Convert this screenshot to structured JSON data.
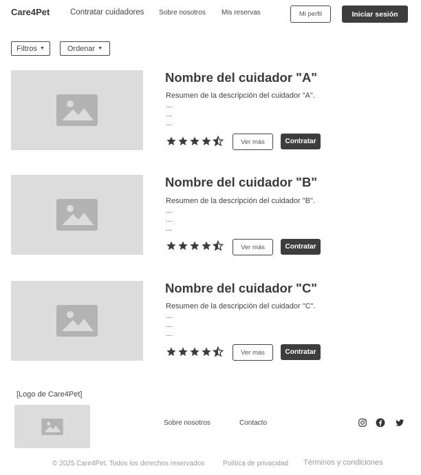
{
  "header": {
    "logo": "Care4Pet",
    "nav": [
      "Contratar cuidadores",
      "Sobre nosotros",
      "Mis reservas"
    ],
    "profile_button": "Mi perfil",
    "login_button": "Iniciar sesión"
  },
  "filters": {
    "filter_label": "Filtros",
    "sort_label": "Ordenar"
  },
  "caregivers": [
    {
      "name": "Nombre del cuidador \"A\"",
      "summary": "Resumen de la descripción del cuidador \"A\".",
      "rating": 4.5,
      "view_label": "Ver más",
      "hire_label": "Contratar"
    },
    {
      "name": "Nombre del cuidador \"B\"",
      "summary": "Resumen de la descripción del cuidador \"B\".",
      "rating": 4.5,
      "view_label": "Ver más",
      "hire_label": "Contratar"
    },
    {
      "name": "Nombre del cuidador \"C\"",
      "summary": "Resumen de la descripción del cuidador \"C\".",
      "rating": 4.5,
      "view_label": "Ver más",
      "hire_label": "Contratar"
    }
  ],
  "ellipsis": "...",
  "footer": {
    "logo_label": "[Logo de Care4Pet]",
    "links": [
      "Sobre nosotros",
      "Contacto"
    ],
    "social_icons": [
      "instagram-icon",
      "facebook-icon",
      "twitter-icon"
    ],
    "copyright": "© 2025 Care4Pet. Todos los derechos reservados",
    "privacy": "Política de privacidad",
    "terms": "Términos y condiciones"
  },
  "colors": {
    "primary_dark": "#3d3d3d",
    "placeholder_bg": "#dcdcdc",
    "placeholder_icon": "#b3b3b3",
    "muted_text": "#999999"
  }
}
